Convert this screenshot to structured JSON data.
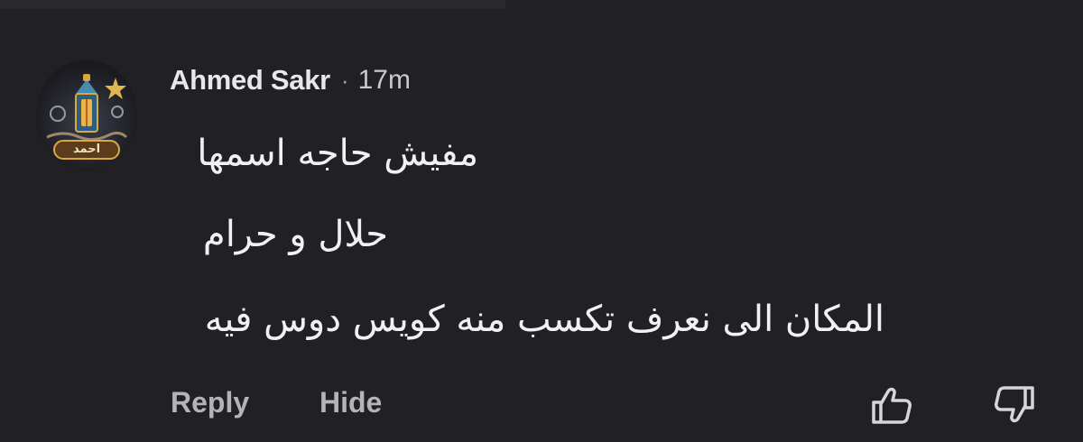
{
  "comment": {
    "author": "Ahmed Sakr",
    "separator": "·",
    "timestamp": "17m",
    "avatar_label": "احمد",
    "message_lines": [
      "مفيش حاجه اسمها",
      "حلال و حرام",
      "المكان الى نعرف تكسب منه كويس دوس فيه"
    ],
    "actions": {
      "reply": "Reply",
      "hide": "Hide"
    },
    "icons": {
      "like": "thumbs-up-icon",
      "dislike": "thumbs-down-icon"
    }
  },
  "colors": {
    "background": "#212124",
    "text_primary": "#f1f1f3",
    "text_secondary": "#b3b4b8",
    "avatar_gold": "#d9a843"
  }
}
